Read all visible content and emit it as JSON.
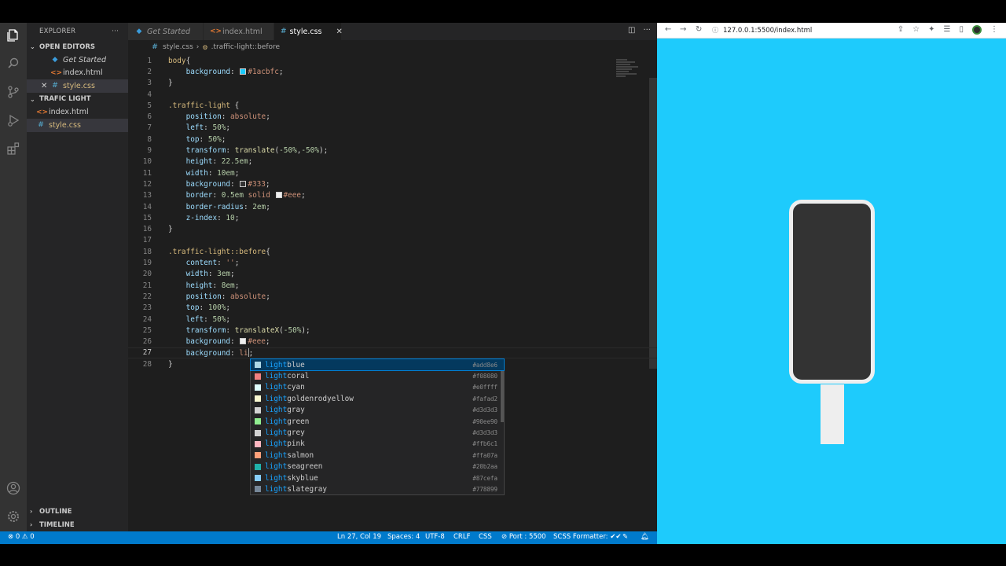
{
  "explorer": {
    "title": "EXPLORER",
    "more": "···",
    "open_editors": "OPEN EDITORS",
    "open_items": [
      {
        "icon": "vs",
        "name": "Get Started"
      },
      {
        "icon": "html",
        "name": "index.html"
      },
      {
        "icon": "css",
        "name": "style.css"
      }
    ],
    "folder": "TRAFIC LIGHT",
    "folder_items": [
      {
        "icon": "html",
        "name": "index.html"
      },
      {
        "icon": "css",
        "name": "style.css"
      }
    ],
    "outline": "OUTLINE",
    "timeline": "TIMELINE"
  },
  "tabs": [
    {
      "name": "Get Started"
    },
    {
      "name": "index.html"
    },
    {
      "name": "style.css"
    }
  ],
  "breadcrumb": {
    "file": "style.css",
    "symbol": ".traffic-light::before"
  },
  "code_lines": [
    {
      "n": "1",
      "html": "<span class='sel'>body</span><span class='pun'>{</span>"
    },
    {
      "n": "2",
      "html": "    <span class='prop'>background</span><span class='pun'>: </span><span class='swatch' style='background:#1acbfc'></span><span class='val'>#1acbfc</span><span class='pun'>;</span>"
    },
    {
      "n": "3",
      "html": "<span class='pun'>}</span>"
    },
    {
      "n": "4",
      "html": ""
    },
    {
      "n": "5",
      "html": "<span class='sel'>.traffic-light</span><span class='pun'> {</span>"
    },
    {
      "n": "6",
      "html": "    <span class='prop'>position</span><span class='pun'>: </span><span class='val'>absolute</span><span class='pun'>;</span>"
    },
    {
      "n": "7",
      "html": "    <span class='prop'>left</span><span class='pun'>: </span><span class='num'>50%</span><span class='pun'>;</span>"
    },
    {
      "n": "8",
      "html": "    <span class='prop'>top</span><span class='pun'>: </span><span class='num'>50%</span><span class='pun'>;</span>"
    },
    {
      "n": "9",
      "html": "    <span class='prop'>transform</span><span class='pun'>: </span><span class='fn'>translate</span><span class='pun'>(</span><span class='num'>-50%</span><span class='pun'>,</span><span class='num'>-50%</span><span class='pun'>);</span>"
    },
    {
      "n": "10",
      "html": "    <span class='prop'>height</span><span class='pun'>: </span><span class='num'>22.5em</span><span class='pun'>;</span>"
    },
    {
      "n": "11",
      "html": "    <span class='prop'>width</span><span class='pun'>: </span><span class='num'>10em</span><span class='pun'>;</span>"
    },
    {
      "n": "12",
      "html": "    <span class='prop'>background</span><span class='pun'>: </span><span class='swatch' style='background:#333'></span><span class='val'>#333</span><span class='pun'>;</span>"
    },
    {
      "n": "13",
      "html": "    <span class='prop'>border</span><span class='pun'>: </span><span class='num'>0.5em</span><span class='val'> solid </span><span class='swatch' style='background:#eee'></span><span class='val'>#eee</span><span class='pun'>;</span>"
    },
    {
      "n": "14",
      "html": "    <span class='prop'>border-radius</span><span class='pun'>: </span><span class='num'>2em</span><span class='pun'>;</span>"
    },
    {
      "n": "15",
      "html": "    <span class='prop'>z-index</span><span class='pun'>: </span><span class='num'>10</span><span class='pun'>;</span>"
    },
    {
      "n": "16",
      "html": "<span class='pun'>}</span>"
    },
    {
      "n": "17",
      "html": ""
    },
    {
      "n": "18",
      "html": "<span class='sel'>.traffic-light::before</span><span class='pun'>{</span>"
    },
    {
      "n": "19",
      "html": "    <span class='prop'>content</span><span class='pun'>: </span><span class='val'>''</span><span class='pun'>;</span>"
    },
    {
      "n": "20",
      "html": "    <span class='prop'>width</span><span class='pun'>: </span><span class='num'>3em</span><span class='pun'>;</span>"
    },
    {
      "n": "21",
      "html": "    <span class='prop'>height</span><span class='pun'>: </span><span class='num'>8em</span><span class='pun'>;</span>"
    },
    {
      "n": "22",
      "html": "    <span class='prop'>position</span><span class='pun'>: </span><span class='val'>absolute</span><span class='pun'>;</span>"
    },
    {
      "n": "23",
      "html": "    <span class='prop'>top</span><span class='pun'>: </span><span class='num'>100%</span><span class='pun'>;</span>"
    },
    {
      "n": "24",
      "html": "    <span class='prop'>left</span><span class='pun'>: </span><span class='num'>50%</span><span class='pun'>;</span>"
    },
    {
      "n": "25",
      "html": "    <span class='prop'>transform</span><span class='pun'>: </span><span class='fn'>translateX</span><span class='pun'>(</span><span class='num'>-50%</span><span class='pun'>);</span>"
    },
    {
      "n": "26",
      "html": "    <span class='prop'>background</span><span class='pun'>: </span><span class='swatch' style='background:#eee'></span><span class='val'>#eee</span><span class='pun'>;</span>"
    },
    {
      "n": "27",
      "html": "    <span class='prop'>background</span><span class='pun'>: </span><span class='val'>li</span><span class='cursor'></span><span class='pun'>;</span>"
    },
    {
      "n": "28",
      "html": "<span class='pun'>}</span>"
    }
  ],
  "suggestions": [
    {
      "name": "lightblue",
      "hex": "#add8e6",
      "color": "#add8e6"
    },
    {
      "name": "lightcoral",
      "hex": "#f08080",
      "color": "#f08080"
    },
    {
      "name": "lightcyan",
      "hex": "#e0ffff",
      "color": "#e0ffff"
    },
    {
      "name": "lightgoldenrodyellow",
      "hex": "#fafad2",
      "color": "#fafad2"
    },
    {
      "name": "lightgray",
      "hex": "#d3d3d3",
      "color": "#d3d3d3"
    },
    {
      "name": "lightgreen",
      "hex": "#90ee90",
      "color": "#90ee90"
    },
    {
      "name": "lightgrey",
      "hex": "#d3d3d3",
      "color": "#d3d3d3"
    },
    {
      "name": "lightpink",
      "hex": "#ffb6c1",
      "color": "#ffb6c1"
    },
    {
      "name": "lightsalmon",
      "hex": "#ffa07a",
      "color": "#ffa07a"
    },
    {
      "name": "lightseagreen",
      "hex": "#20b2aa",
      "color": "#20b2aa"
    },
    {
      "name": "lightskyblue",
      "hex": "#87cefa",
      "color": "#87cefa"
    },
    {
      "name": "lightslategray",
      "hex": "#778899",
      "color": "#778899"
    }
  ],
  "status": {
    "problems": "⊗ 0 ⚠ 0",
    "position": "Ln 27, Col 19",
    "spaces": "Spaces: 4",
    "encoding": "UTF-8",
    "eol": "CRLF",
    "language": "CSS",
    "port": "⊘ Port : 5500",
    "formatter": "SCSS Formatter: ✔✔"
  },
  "browser": {
    "url": "127.0.0.1:5500/index.html",
    "page_bg": "#1acbfc"
  }
}
